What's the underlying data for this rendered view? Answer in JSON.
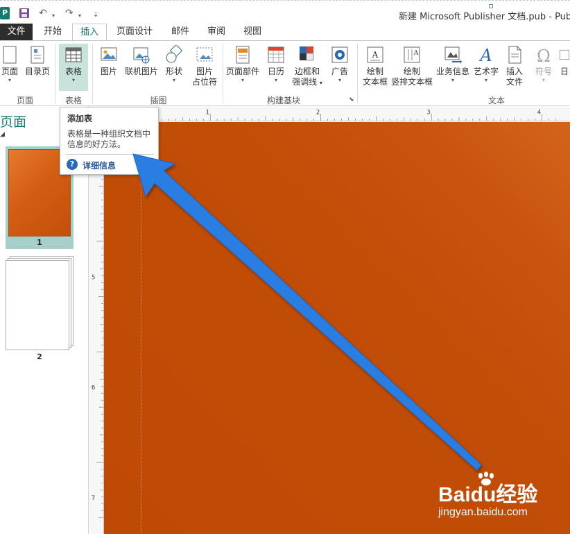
{
  "window": {
    "app_icon_letter": "P",
    "title": "新建 Microsoft Publisher 文档.pub - Publish"
  },
  "tabs": {
    "file": "文件",
    "items": [
      {
        "label": "开始"
      },
      {
        "label": "插入"
      },
      {
        "label": "页面设计"
      },
      {
        "label": "邮件"
      },
      {
        "label": "审阅"
      },
      {
        "label": "视图"
      }
    ],
    "active": "插入"
  },
  "ribbon": {
    "groups": {
      "pages": "页面",
      "tables": "表格",
      "illustrations": "插图",
      "building_blocks": "构建基块",
      "text": "文本"
    },
    "buttons": {
      "page": "页面",
      "catalog_page": "目录页",
      "table": "表格",
      "picture": "图片",
      "online_pictures": "联机图片",
      "shapes": "形状",
      "picture_placeholder_1": "图片",
      "picture_placeholder_2": "占位符",
      "page_parts": "页面部件",
      "calendar": "日历",
      "borders_1": "边框和",
      "borders_2": "强调线",
      "advertisements": "广告",
      "draw_textbox_1": "绘制",
      "draw_textbox_2": "文本框",
      "draw_vertical_1": "绘制",
      "draw_vertical_2": "竖排文本框",
      "business_info": "业务信息",
      "wordart": "艺术字",
      "insert_file_1": "插入",
      "insert_file_2": "文件",
      "symbol": "符号",
      "date_partial": "日"
    },
    "dropdown_caret": "▾"
  },
  "pages_pane": {
    "title": "页面",
    "collapse_glyph": "◢",
    "pages": [
      {
        "number": "1"
      },
      {
        "number": "2"
      }
    ]
  },
  "ruler": {
    "h_labels": [
      "1",
      "2",
      "3",
      "4"
    ],
    "v_labels": [
      "5",
      "6",
      "7"
    ]
  },
  "tooltip": {
    "title": "添加表",
    "description": "表格是一种组织文档中信息的好方法。",
    "help_glyph": "?",
    "more_info": "详细信息"
  },
  "watermark": {
    "logo": "Baidu经验",
    "url": "jingyan.baidu.com"
  },
  "colors": {
    "accent": "#107c6f",
    "file_tab": "#2d2d2d",
    "canvas": "#c14d07",
    "arrow": "#2a7de1",
    "table_pressed": "#c8e2dc"
  }
}
